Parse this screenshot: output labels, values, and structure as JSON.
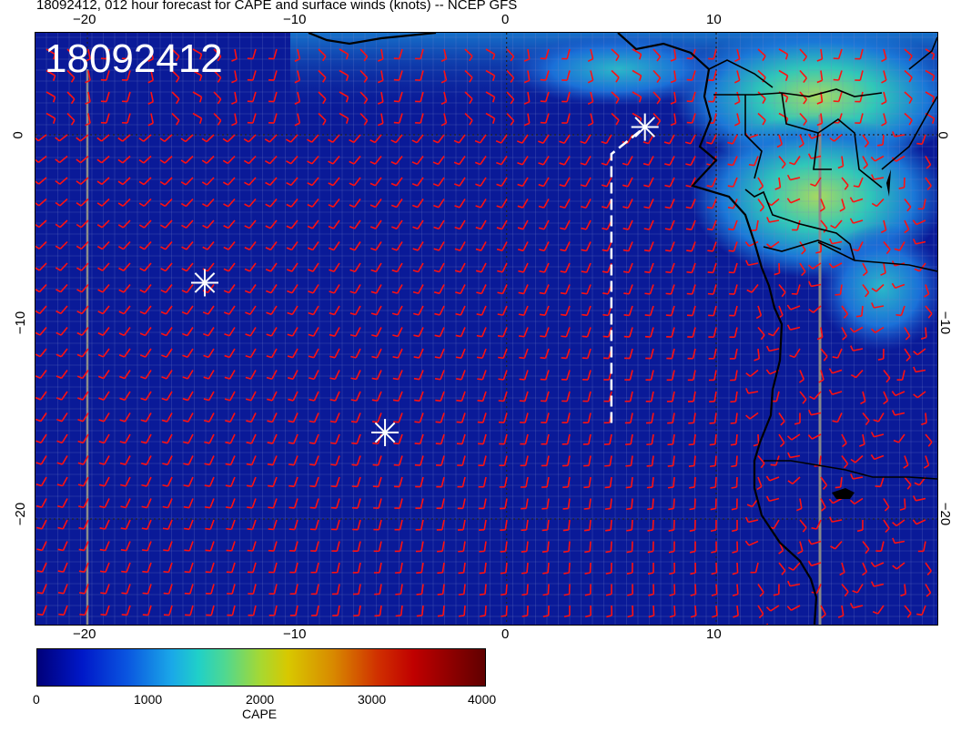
{
  "title": "18092412, 012 hour forecast for CAPE and surface winds (knots) -- NCEP GFS",
  "stamp": "18092412",
  "axes": {
    "lon_range": [
      -22.5,
      20
    ],
    "lat_range": [
      -25,
      5
    ],
    "top_ticks": [
      "−20",
      "−10",
      "0",
      "10"
    ],
    "bottom_ticks": [
      "−20",
      "−10",
      "0",
      "10"
    ],
    "left_ticks": [
      "0",
      "−10",
      "−20"
    ],
    "right_ticks": [
      "0",
      "−10",
      "−20"
    ]
  },
  "colorbar": {
    "title": "CAPE",
    "labels": [
      "0",
      "1000",
      "2000",
      "3000",
      "4000"
    ],
    "range": [
      0,
      4000
    ]
  },
  "markers": [
    {
      "name": "star-1",
      "lon": -14.4,
      "lat": -7.7
    },
    {
      "name": "star-2",
      "lon": -5.8,
      "lat": -15.5
    },
    {
      "name": "star-3",
      "lon": 6.6,
      "lat": 0.4
    }
  ],
  "track": [
    [
      5,
      -15
    ],
    [
      5,
      -1
    ],
    [
      6.6,
      0.4
    ]
  ],
  "colors": {
    "ocean": "#0a1a98",
    "barb": "#ff1010",
    "coast": "#000000",
    "marker": "#ffffff",
    "grid": "#7b86c8"
  }
}
